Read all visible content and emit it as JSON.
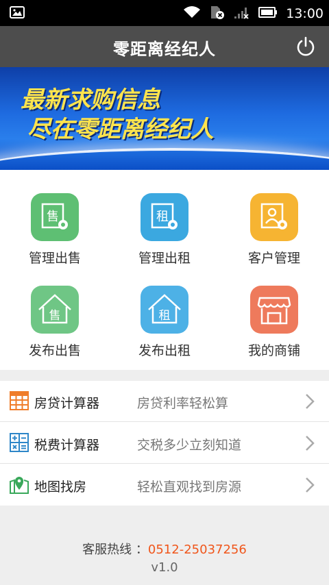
{
  "status_bar": {
    "time": "13:00"
  },
  "header": {
    "title": "零距离经纪人"
  },
  "banner": {
    "line1": "最新求购信息",
    "line2": "尽在零距离经纪人",
    "active_dot_color": "#f05a28",
    "inactive_dot_color": "#b9c9e6"
  },
  "grid": {
    "items": [
      {
        "label": "管理出售",
        "icon": "sell-manage-icon",
        "color": "#5ebf73",
        "glyph": "售"
      },
      {
        "label": "管理出租",
        "icon": "rent-manage-icon",
        "color": "#3ba8e0",
        "glyph": "租"
      },
      {
        "label": "客户管理",
        "icon": "customer-manage-icon",
        "color": "#f6b432"
      },
      {
        "label": "发布出售",
        "icon": "publish-sell-icon",
        "color": "#6fc685",
        "glyph": "售"
      },
      {
        "label": "发布出租",
        "icon": "publish-rent-icon",
        "color": "#4db1e6",
        "glyph": "租"
      },
      {
        "label": "我的商铺",
        "icon": "my-shop-icon",
        "color": "#ee7a5c"
      }
    ]
  },
  "list": {
    "rows": [
      {
        "title": "房贷计算器",
        "desc": "房贷利率轻松算",
        "icon": "calculator-grid-icon",
        "color": "#ef7d2a"
      },
      {
        "title": "税费计算器",
        "desc": "交税多少立刻知道",
        "icon": "calculator-icon",
        "color": "#2d86c8"
      },
      {
        "title": "地图找房",
        "desc": "轻松直观找到房源",
        "icon": "map-pin-icon",
        "color": "#39a85a"
      }
    ]
  },
  "footer": {
    "hotline_label": "客服热线 ：",
    "hotline_number": "0512-25037256",
    "version": "v1.0"
  }
}
